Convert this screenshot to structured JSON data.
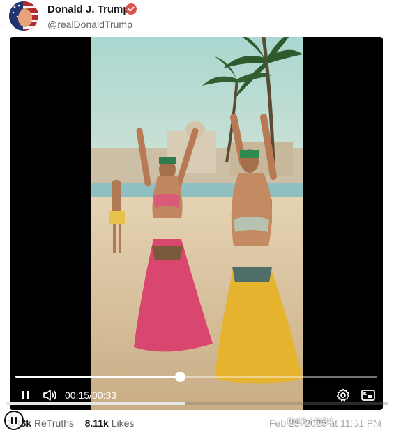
{
  "post": {
    "author_name": "Donald J. Trump",
    "author_handle": "@realDonaldTrump",
    "verified": true,
    "date_text": "Feb 25, 2025 at 11:01 PM"
  },
  "player": {
    "current_time": "00:15",
    "separator": "/",
    "duration": "00:33",
    "progress_fraction": 0.455,
    "state": "playing",
    "icons": [
      "pause-icon",
      "volume-icon",
      "settings-icon",
      "picture-in-picture-icon"
    ]
  },
  "overlay_controls": {
    "time_text": "0:16 / 0:34",
    "progress_fraction": 0.47,
    "icons": [
      "pause-icon",
      "volume-icon",
      "expand-icon"
    ]
  },
  "stats": {
    "retruths_count": "2.48k",
    "retruths_label": "ReTruths",
    "likes_count": "8.11k",
    "likes_label": "Likes"
  },
  "colors": {
    "verified_badge": "#d9534f",
    "text_primary": "#1d1d1f",
    "text_secondary": "#5f6368",
    "video_background": "#000000"
  }
}
